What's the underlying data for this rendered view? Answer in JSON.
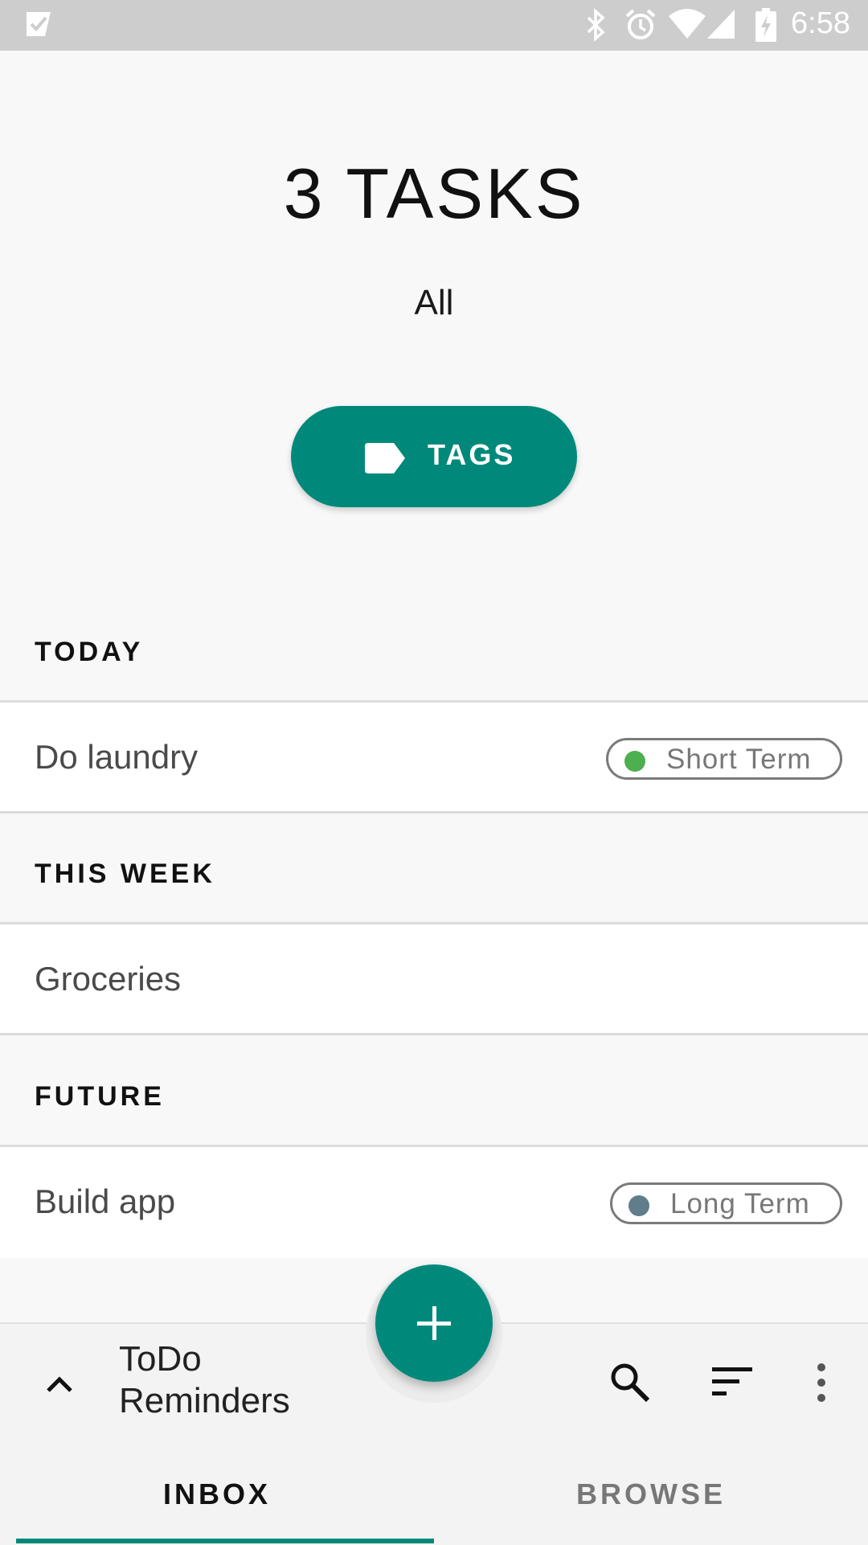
{
  "status_bar": {
    "time": "6:58"
  },
  "header": {
    "count_title": "3 TASKS",
    "filter": "All",
    "tags_button": "TAGS"
  },
  "sections": [
    {
      "label": "TODAY",
      "tasks": [
        {
          "title": "Do laundry",
          "tag": "Short Term",
          "tag_color": "#4caf50"
        }
      ]
    },
    {
      "label": "THIS WEEK",
      "tasks": [
        {
          "title": "Groceries"
        }
      ]
    },
    {
      "label": "FUTURE",
      "tasks": [
        {
          "title": "Build app",
          "tag": "Long Term",
          "tag_color": "#607d8b"
        }
      ]
    }
  ],
  "bottom_bar": {
    "app_title": "ToDo Reminders",
    "icons": [
      "chevron-up-icon",
      "search-icon",
      "sort-icon",
      "more-vert-icon"
    ],
    "tabs": [
      {
        "label": "INBOX",
        "selected": true
      },
      {
        "label": "BROWSE",
        "selected": false
      }
    ]
  },
  "colors": {
    "accent": "#00897b",
    "status_bar": "#cdcdcd"
  }
}
